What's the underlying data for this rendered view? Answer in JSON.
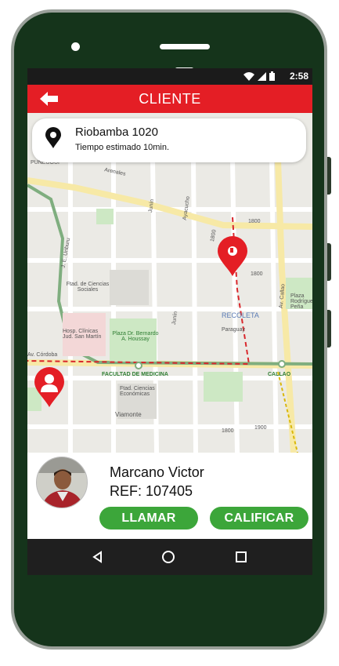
{
  "status_bar": {
    "time": "2:58",
    "icons": [
      "wifi-icon",
      "signal-icon",
      "battery-icon"
    ]
  },
  "app_bar": {
    "title": "CLIENTE",
    "back_icon": "arrow-left-icon",
    "color": "#e41e25"
  },
  "destination": {
    "address": "Riobamba 1020",
    "eta": "Tiempo estimado 10min."
  },
  "map": {
    "labels": {
      "arenales": "Arenales",
      "junin1": "Junín",
      "ayacucho": "Ayacucho",
      "n1800a": "1800",
      "n1800b": "1800",
      "n1800c": "1800",
      "n1800d": "1800",
      "ciencias_sociales": "Ftad. de Ciencias Sociales",
      "junin2": "Junín",
      "recoleta": "RECOLETA",
      "paraguay": "Paraguay",
      "av_callao": "Av. Callao",
      "plaza_rodriguez": "Plaza Rodríguez Peña",
      "hosp_clinicas": "Hosp. Clínicas Jud. San Martín",
      "plaza_houssay": "Plaza Dr. Bernardo A. Houssay",
      "av_cordoba": "Av. Córdoba",
      "facultad_medicina": "FACULTAD DE MEDICINA",
      "callao": "CALLAO",
      "ciencias_economicas": "Ftad. Ciencias Económicas",
      "viamonte": "Viamonte",
      "n1900": "1900",
      "uriburu": "J. E. Uriburu",
      "puneugui": "PUNEUGUI"
    },
    "route_color": "#d9262b",
    "street_color": "#f7e9a6",
    "park_color": "#cde8c4"
  },
  "driver": {
    "name": "Marcano Victor",
    "ref": "REF: 107405",
    "call_label": "LLAMAR",
    "rate_label": "CALIFICAR",
    "button_color": "#3ca63a"
  },
  "nav_bar": {
    "buttons": [
      "back-triangle-icon",
      "home-circle-icon",
      "recents-square-icon"
    ]
  }
}
